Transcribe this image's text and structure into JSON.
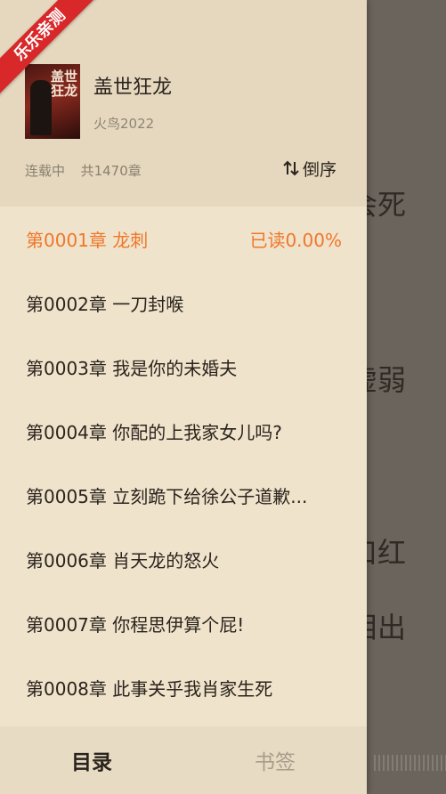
{
  "badge": {
    "label": "乐乐亲测"
  },
  "book": {
    "title": "盖世狂龙",
    "author": "火鸟2022",
    "status": "连载中",
    "chapter_count": "共1470章",
    "cover_text": "盖世狂龙"
  },
  "sort": {
    "label": "倒序",
    "icon": "sort-arrows-icon"
  },
  "chapters": [
    {
      "title": "第0001章 龙刺",
      "read": "已读0.00%"
    },
    {
      "title": "第0002章 一刀封喉"
    },
    {
      "title": "第0003章 我是你的未婚夫"
    },
    {
      "title": "第0004章 你配的上我家女儿吗?"
    },
    {
      "title": "第0005章 立刻跪下给徐公子道歉..."
    },
    {
      "title": "第0006章 肖天龙的怒火"
    },
    {
      "title": "第0007章 你程思伊算个屁!"
    },
    {
      "title": "第0008章 此事关乎我肖家生死"
    }
  ],
  "tabs": {
    "catalog": "目录",
    "bookmark": "书签"
  },
  "background_text": [
    "会死",
    "虚弱",
    "口红",
    "泪出",
    "。"
  ],
  "colors": {
    "accent": "#f0772a",
    "panel": "#efe3cc",
    "header": "#e5d8be",
    "ribbon": "#d8282a"
  }
}
